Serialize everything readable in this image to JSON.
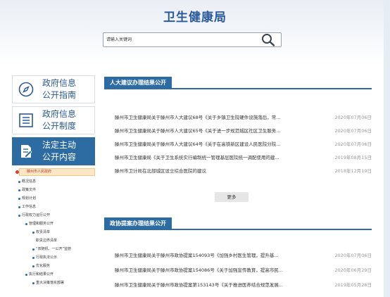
{
  "header": {
    "title": "卫生健康局",
    "search_placeholder": "请输入关键词"
  },
  "sidebar": {
    "cards": [
      {
        "line1": "政府信息",
        "line2": "公开指南",
        "icon": "compass-icon"
      },
      {
        "line1": "政府信息",
        "line2": "公开制度",
        "icon": "list-icon"
      },
      {
        "line1": "法定主动",
        "line2": "公开内容",
        "icon": "document-edit-icon"
      }
    ],
    "tree": {
      "root": "滕州市人民政府",
      "items": [
        "概况信息",
        "政策文件",
        "规划计划",
        "工作信息",
        "行政权力运行公开",
        "管理和服务公开",
        "权责清单",
        "职责边界清单",
        "“双随机、一公开”监管",
        "行政执法公示",
        "优化服务",
        "执行和结果公开",
        "重大决策落实部署"
      ]
    }
  },
  "sections": [
    {
      "title": "人大建议办理结果公开",
      "rows": [
        {
          "title": "滕州市卫生健康局关于滕州市人大建议68号《关于乡镇卫生院硬件设施落后，常...",
          "date": "2020年07月06日"
        },
        {
          "title": "滕州市卫生健康局关于滕州市人大建议65号《关于进一步规范城区社区卫生服务...",
          "date": "2020年07月06日"
        },
        {
          "title": "滕州市卫生健康局关于滕州市人大建议64号《关于在高铁新区建设人民医院分院...",
          "date": "2020年07月06日"
        },
        {
          "title": "滕州市卫生健康局《关于卫生系统实行编制统一管理基层医院统一调配使用的建...",
          "date": "2019年08月15日"
        },
        {
          "title": "滕州市卫计局在北部城区设立综合医院的建议",
          "date": "2018年12月19日"
        }
      ],
      "more_label": "更多"
    },
    {
      "title": "政协提案办理结果公开",
      "rows": [
        {
          "title": "滕州市卫生健康局关于滕州市政协提案154093号《加强乡村医生管理，提升基...",
          "date": "2020年07月06日"
        },
        {
          "title": "滕州市卫生健康局关于滕州市政协提案154086号《关于加强宣传教育，提高市民...",
          "date": "2020年06月29日"
        },
        {
          "title": "滕州市卫生健康局关于滕州市政协提案第153143号《关于推进医养结合规范发展...",
          "date": "2019年05月28日"
        }
      ]
    }
  ]
}
